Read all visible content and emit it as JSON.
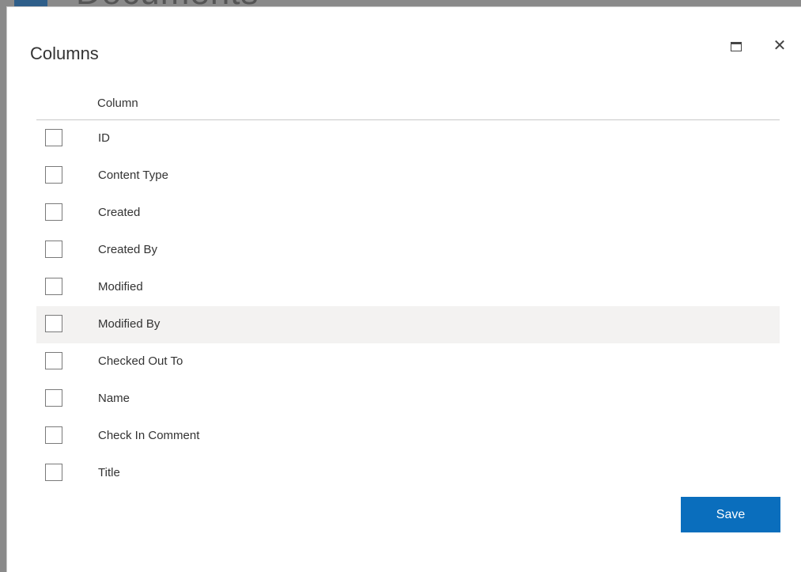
{
  "background": {
    "page_title_fragment": "Documents"
  },
  "dialog": {
    "title": "Columns",
    "maximize_icon": "maximize-icon",
    "close_icon": "close-icon",
    "close_glyph": "✕"
  },
  "table": {
    "header": "Column",
    "rows": [
      {
        "label": "ID",
        "checked": false
      },
      {
        "label": "Content Type",
        "checked": false
      },
      {
        "label": "Created",
        "checked": false
      },
      {
        "label": "Created By",
        "checked": false
      },
      {
        "label": "Modified",
        "checked": false
      },
      {
        "label": "Modified By",
        "checked": false
      },
      {
        "label": "Checked Out To",
        "checked": false
      },
      {
        "label": "Name",
        "checked": false
      },
      {
        "label": "Check In Comment",
        "checked": false
      },
      {
        "label": "Title",
        "checked": false
      }
    ]
  },
  "footer": {
    "save_label": "Save"
  },
  "colors": {
    "accent": "#0a6ebd",
    "hover_row": "#f3f2f1"
  }
}
